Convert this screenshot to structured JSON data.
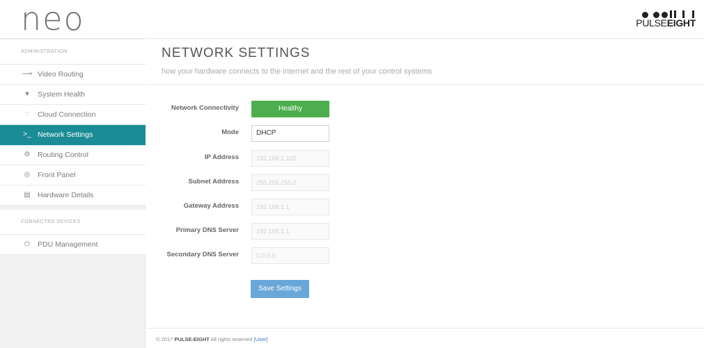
{
  "logo": "neo",
  "brand": {
    "name_light": "PULSE",
    "name_bold": "EIGHT"
  },
  "sidebar": {
    "admin_heading": "ADMINISTRATION",
    "items": [
      {
        "label": "Video Routing",
        "icon": "home-icon"
      },
      {
        "label": "System Health",
        "icon": "heart-icon"
      },
      {
        "label": "Cloud Connection",
        "icon": "wifi-icon"
      },
      {
        "label": "Network Settings",
        "icon": "terminal-icon",
        "active": true
      },
      {
        "label": "Routing Control",
        "icon": "gears-icon"
      },
      {
        "label": "Front Panel",
        "icon": "panel-icon"
      },
      {
        "label": "Hardware Details",
        "icon": "hardware-icon"
      }
    ],
    "devices_heading": "CONNECTED DEVICES",
    "device_items": [
      {
        "label": "PDU Management",
        "icon": "power-icon"
      }
    ]
  },
  "page": {
    "title": "NETWORK SETTINGS",
    "subtitle": "how your hardware connects to the internet and the rest of your control systems"
  },
  "form": {
    "connectivity_label": "Network Connectivity",
    "connectivity_status": "Healthy",
    "mode_label": "Mode",
    "mode_value": "DHCP",
    "ip_label": "IP Address",
    "ip_value": "192.168.1.102",
    "subnet_label": "Subnet Address",
    "subnet_value": "255.255.255.0",
    "gateway_label": "Gateway Address",
    "gateway_value": "192.168.1.1",
    "dns1_label": "Primary DNS Server",
    "dns1_value": "192.168.1.1",
    "dns2_label": "Secondary DNS Server",
    "dns2_value": "0.0.0.0",
    "save_label": "Save Settings"
  },
  "footer": {
    "copyright": "© 2017",
    "company": "PULSE-EIGHT",
    "rights": "All rights reserved",
    "user_link": "[User]"
  },
  "colors": {
    "active_nav": "#1b8c96",
    "healthy": "#4cae4c",
    "save_button": "#6aa7d9"
  }
}
